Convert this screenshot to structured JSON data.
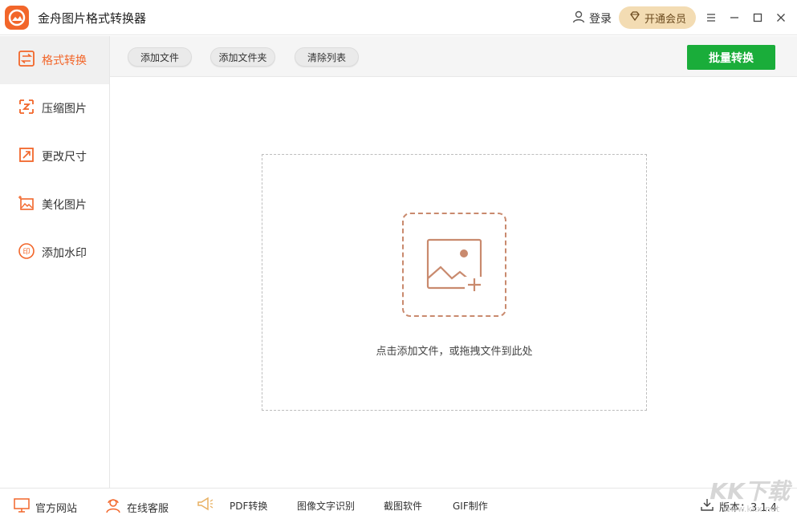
{
  "app": {
    "title": "金舟图片格式转换器"
  },
  "header": {
    "login_label": "登录",
    "vip_label": "开通会员"
  },
  "sidebar": {
    "items": [
      {
        "label": "格式转换",
        "icon": "format-convert-icon"
      },
      {
        "label": "压缩图片",
        "icon": "compress-icon"
      },
      {
        "label": "更改尺寸",
        "icon": "resize-icon"
      },
      {
        "label": "美化图片",
        "icon": "beautify-icon"
      },
      {
        "label": "添加水印",
        "icon": "watermark-icon"
      }
    ]
  },
  "toolbar": {
    "add_file": "添加文件",
    "add_folder": "添加文件夹",
    "clear_list": "清除列表",
    "batch_convert": "批量转换"
  },
  "drop_zone": {
    "hint": "点击添加文件，或拖拽文件到此处"
  },
  "footer": {
    "website": "官方网站",
    "support": "在线客服",
    "pdf": "PDF转换",
    "ocr": "图像文字识别",
    "screenshot": "截图软件",
    "gif": "GIF制作",
    "version": "版本：3.1.4"
  },
  "watermark": {
    "brand": "KK下载",
    "url": "www.kkx.net"
  },
  "colors": {
    "accent": "#f2662a",
    "primary_button": "#1aad3a",
    "vip_bg": "#f3dcb3"
  }
}
